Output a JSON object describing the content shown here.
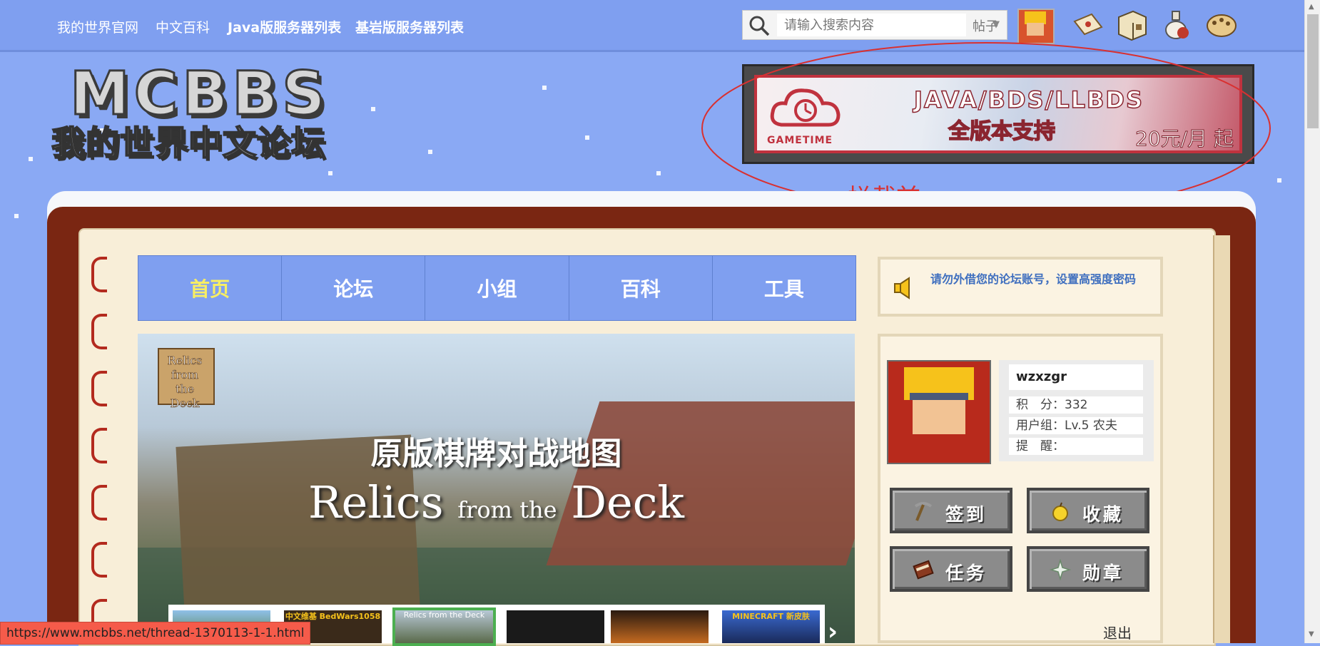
{
  "topbar": {
    "links": [
      "我的世界官网",
      "中文百科",
      "Java版服务器列表",
      "基岩版服务器列表"
    ],
    "search": {
      "placeholder": "请输入搜索内容",
      "type": "帖子"
    }
  },
  "logo": {
    "line1": "MCBBS",
    "line2": "我的世界中文论坛"
  },
  "banner": {
    "brand": "GAMETIME",
    "line1": "JAVA/BDS/LLBDS",
    "line2": "全版本支持",
    "price": "20元/月 起"
  },
  "annotation": {
    "text": "拦截前",
    "color": "#d93030"
  },
  "nav": {
    "tabs": [
      "首页",
      "论坛",
      "小组",
      "百科",
      "工具"
    ],
    "active_index": 0
  },
  "slider": {
    "thumb_title": "Relics from the Deck",
    "title_cn": "原版棋牌对战地图",
    "title_en_1": "Relics",
    "title_en_small": "from the",
    "title_en_2": "Deck",
    "thumbnails": [
      "",
      "中文维基 BedWars1058",
      "Relics from the Deck",
      "",
      "",
      "MINECRAFT 新皮肤"
    ]
  },
  "notice": {
    "text": "请勿外借您的论坛账号，设置高强度密码"
  },
  "user": {
    "name": "wzxzgr",
    "points": "积　分：332",
    "group": "用户组：Lv.5 农夫",
    "reminder": "提　醒："
  },
  "actions": {
    "checkin": "签到",
    "favorites": "收藏",
    "tasks": "任务",
    "medals": "勋章",
    "logout": "退出"
  },
  "status_url": "https://www.mcbbs.net/thread-1370113-1-1.html",
  "colors": {
    "nav": "#7f9ff0",
    "active_tab": "#f7ee64",
    "book": "#7a2612",
    "page": "#f8eed8",
    "notice_text": "#3f6fbf",
    "status_bar": "#f55b4a"
  }
}
